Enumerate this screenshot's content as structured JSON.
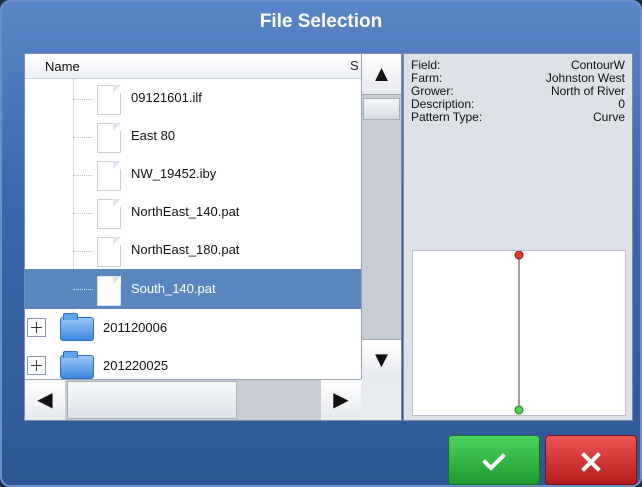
{
  "dialog": {
    "title": "File Selection"
  },
  "list": {
    "column_name": "Name",
    "column_s": "S",
    "files": [
      {
        "label": "09121601.ilf"
      },
      {
        "label": "East 80"
      },
      {
        "label": "NW_19452.iby"
      },
      {
        "label": "NorthEast_140.pat"
      },
      {
        "label": "NorthEast_180.pat"
      },
      {
        "label": "South_140.pat",
        "selected": true
      }
    ],
    "folders": [
      {
        "label": "201120006"
      },
      {
        "label": "201220025"
      }
    ]
  },
  "details": {
    "field_label": "Field:",
    "field_value": "ContourW",
    "farm_label": "Farm:",
    "farm_value": "Johnston West",
    "grower_label": "Grower:",
    "grower_value": "North of River",
    "description_label": "Description:",
    "description_value": "0",
    "pattern_label": "Pattern Type:",
    "pattern_value": "Curve"
  },
  "buttons": {
    "ok_icon": "check-icon",
    "cancel_icon": "x-icon"
  },
  "colors": {
    "selected_row": "#5a87bf",
    "ok": "#22a335",
    "cancel": "#c62424"
  }
}
